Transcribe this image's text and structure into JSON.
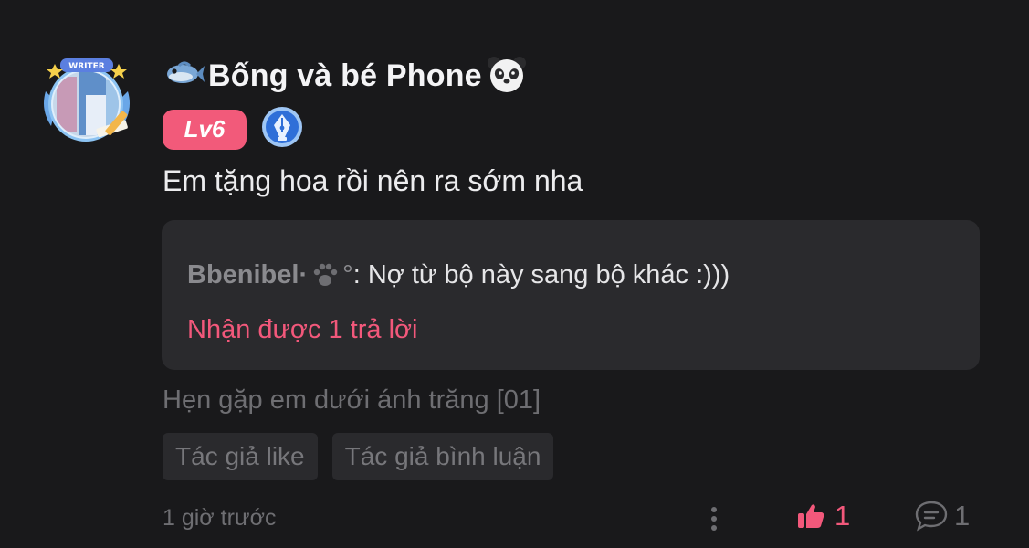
{
  "user": {
    "name": "Bống và bé Phone",
    "prefix_icon": "fish-icon",
    "suffix_icon": "panda-icon",
    "avatar_frame_label": "WRITER",
    "level": "Lv6",
    "badge_icon": "pen-nib-badge-icon"
  },
  "comment": {
    "text": "Em tặng hoa rồi nên ra sớm nha",
    "quote": {
      "author": "Bbenibel·",
      "author_icon": "paw-icon",
      "author_suffix": "°",
      "separator": ": ",
      "text": "Nợ từ bộ này sang bộ khác :)))",
      "replies_label": "Nhận được 1 trả lời"
    },
    "chapter_ref": "Hẹn gặp em dưới ánh trăng [01]",
    "tags": [
      "Tác giả like",
      "Tác giả bình luận"
    ],
    "timestamp": "1 giờ trước",
    "like_count": "1",
    "reply_count": "1"
  },
  "colors": {
    "background": "#19191b",
    "accent": "#f2587b",
    "level_badge": "#f25a7a",
    "panel": "#2a2a2d",
    "muted_text": "#6e6e72"
  }
}
